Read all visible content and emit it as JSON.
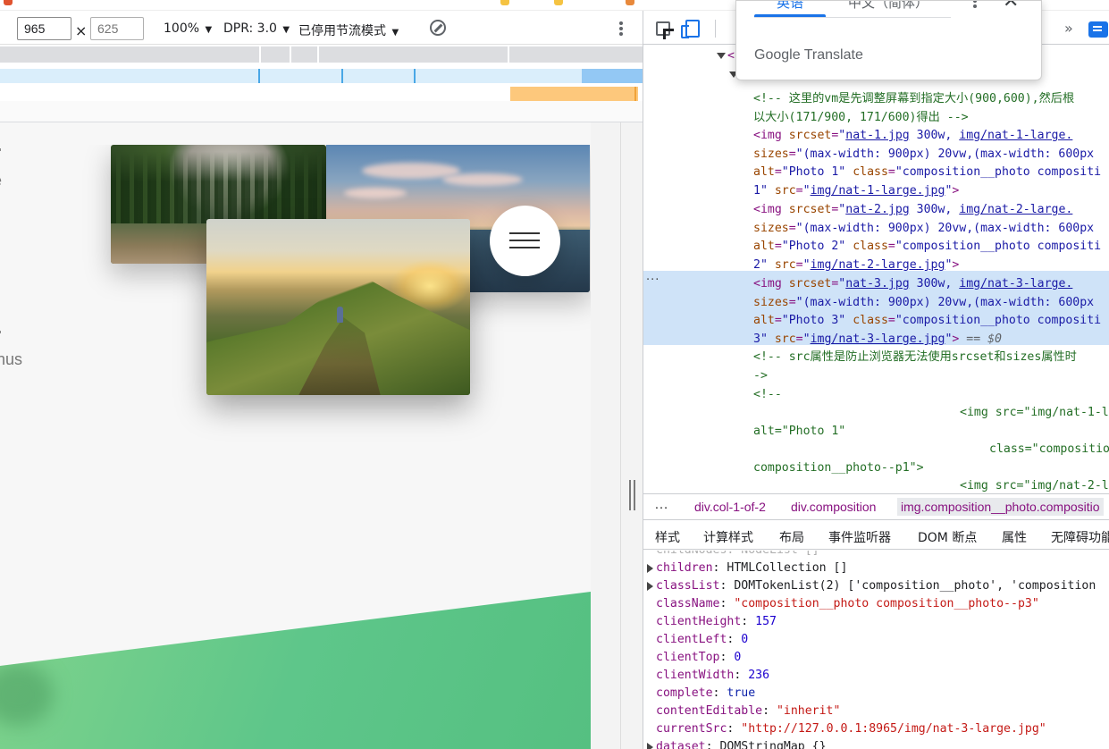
{
  "device_toolbar": {
    "width_value": "965",
    "height_placeholder": "625",
    "times_sign": "×",
    "zoom": "100%",
    "dpr": "DPR: 3.0",
    "throttle": "已停用节流模式",
    "caret": "▼"
  },
  "viewport_page": {
    "text_line_1": "e",
    "text_line_2": "inus",
    "photos": [
      {
        "alt": "Photo 1"
      },
      {
        "alt": "Photo 2"
      },
      {
        "alt": "Photo 3"
      }
    ]
  },
  "translate_popup": {
    "tab_source": "英语",
    "tab_target": "中文（简体）",
    "close": "✕",
    "brand": "Google Translate"
  },
  "devtools": {
    "more_tabs": "»",
    "elements_lines": {
      "l1": "<",
      "comment_1": "<!-- 这里的vm是先调整屏幕到指定大小(900,600),然后根",
      "comment_2": "以大小(171/900, 171/600)得出 -->",
      "img1_a": "nat-1.jpg",
      "img1_b": "img/nat-1-large.jpg",
      "img1_b_short": "img/nat-1-large.",
      "img2_a": "nat-2.jpg",
      "img2_b": "img/nat-2-large.jpg",
      "img2_b_short": "img/nat-2-large.",
      "img3_a": "nat-3.jpg",
      "img3_b": "img/nat-3-large.jpg",
      "img3_b_short": "img/nat-3-large.",
      "sizes": "\"(max-width: 900px) 20vw,(max-width: 600px",
      "dollar_zero": "== $0",
      "comment_3": "<!-- src属性是防止浏览器无法使用srcset和sizes属性时",
      "comment_3b": "->",
      "comment_4": "<!--",
      "raw_1": "<img src=\"img/nat-1-l",
      "raw_alt": "alt=\"Photo 1\"",
      "raw_class": "class=\"compositio",
      "raw_class_2": "composition__photo--p1\">",
      "raw_2": "<img src=\"img/nat-2-l"
    },
    "breadcrumbs": [
      "…",
      "div.col-1-of-2",
      "div.composition",
      "img.composition__photo.compositio"
    ],
    "subtabs": [
      "样式",
      "计算样式",
      "布局",
      "事件监听器",
      "DOM 断点",
      "属性",
      "无障碍功能"
    ],
    "active_subtab": "属性",
    "properties": [
      {
        "key": "children",
        "sep": ": ",
        "value": "HTMLCollection []",
        "type": "o",
        "expandable": true
      },
      {
        "key": "classList",
        "sep": ": ",
        "value": "DOMTokenList(2) ['composition__photo', 'composition",
        "type": "o",
        "expandable": true
      },
      {
        "key": "className",
        "sep": ": ",
        "value": "\"composition__photo composition__photo--p3\"",
        "type": "s",
        "expandable": false
      },
      {
        "key": "clientHeight",
        "sep": ": ",
        "value": "157",
        "type": "n",
        "expandable": false
      },
      {
        "key": "clientLeft",
        "sep": ": ",
        "value": "0",
        "type": "n",
        "expandable": false
      },
      {
        "key": "clientTop",
        "sep": ": ",
        "value": "0",
        "type": "n",
        "expandable": false
      },
      {
        "key": "clientWidth",
        "sep": ": ",
        "value": "236",
        "type": "n",
        "expandable": false
      },
      {
        "key": "complete",
        "sep": ": ",
        "value": "true",
        "type": "k",
        "expandable": false
      },
      {
        "key": "contentEditable",
        "sep": ": ",
        "value": "\"inherit\"",
        "type": "s",
        "expandable": false
      },
      {
        "key": "currentSrc",
        "sep": ": ",
        "value": "\"http://127.0.0.1:8965/img/nat-3-large.jpg\"",
        "type": "s",
        "expandable": false
      },
      {
        "key": "dataset",
        "sep": ": ",
        "value": "DOMStringMap {}",
        "type": "o",
        "expandable": true
      }
    ]
  },
  "colors": {
    "accent": "#1a73e8",
    "selection": "#cfe3f8",
    "tag": "#881280",
    "comment": "#236e25",
    "green_band": "#5ec68a"
  }
}
